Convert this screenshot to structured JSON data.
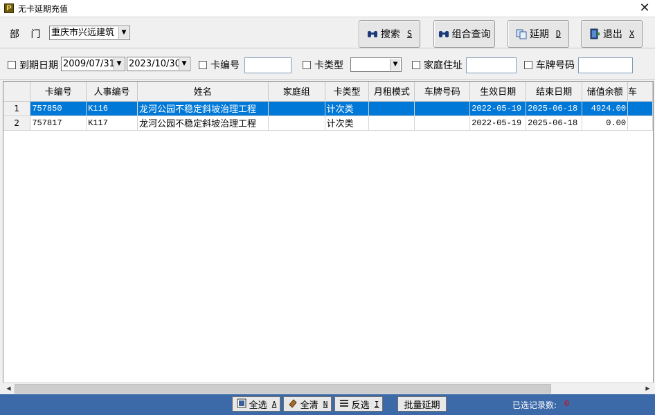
{
  "window": {
    "title": "无卡延期充值",
    "app_icon_letter": "P",
    "close_glyph": "✕"
  },
  "toolbar": {
    "dept_label": "部 门",
    "dept_value": "重庆市兴远建筑",
    "buttons": {
      "search": {
        "label": "搜索",
        "hotkey": "S",
        "icon": "binoculars-icon"
      },
      "combo_query": {
        "label": "组合查询",
        "icon": "binoculars-icon"
      },
      "extend": {
        "label": "延期",
        "hotkey": "D",
        "icon": "copy-icon"
      },
      "exit": {
        "label": "退出",
        "hotkey": "X",
        "icon": "exit-door-icon"
      }
    }
  },
  "filters": {
    "expiry_date_label": "到期日期",
    "date_from": "2009/07/31",
    "date_to": "2023/10/30",
    "card_no_label": "卡编号",
    "card_no_value": "",
    "card_type_label": "卡类型",
    "card_type_value": "",
    "address_label": "家庭住址",
    "address_value": "",
    "plate_label": "车牌号码",
    "plate_value": ""
  },
  "table": {
    "columns": [
      "卡编号",
      "人事编号",
      "姓名",
      "家庭组",
      "卡类型",
      "月租模式",
      "车牌号码",
      "生效日期",
      "结束日期",
      "储值余额",
      "车"
    ],
    "rows": [
      {
        "idx": "1",
        "card_no": "757850",
        "staff_no": "K116",
        "name": "龙河公园不稳定斜坡治理工程",
        "family_group": "",
        "card_type": "计次类",
        "rent_mode": "",
        "plate": "",
        "start_date": "2022-05-19",
        "end_date": "2025-06-18",
        "balance": "4924.00",
        "selected": true
      },
      {
        "idx": "2",
        "card_no": "757817",
        "staff_no": "K117",
        "name": "龙河公园不稳定斜坡治理工程",
        "family_group": "",
        "card_type": "计次类",
        "rent_mode": "",
        "plate": "",
        "start_date": "2022-05-19",
        "end_date": "2025-06-18",
        "balance": "0.00",
        "selected": false
      }
    ]
  },
  "footer": {
    "select_all": {
      "label": "全选",
      "hotkey": "A"
    },
    "clear_all": {
      "label": "全清",
      "hotkey": "N"
    },
    "invert": {
      "label": "反选",
      "hotkey": "I"
    },
    "batch_extend": {
      "label": "批量延期"
    },
    "selected_count_label": "已选记录数:",
    "selected_count": "0"
  },
  "colors": {
    "selection": "#0078d7",
    "statusbar": "#3c6aa8",
    "count_value": "#e00000"
  }
}
